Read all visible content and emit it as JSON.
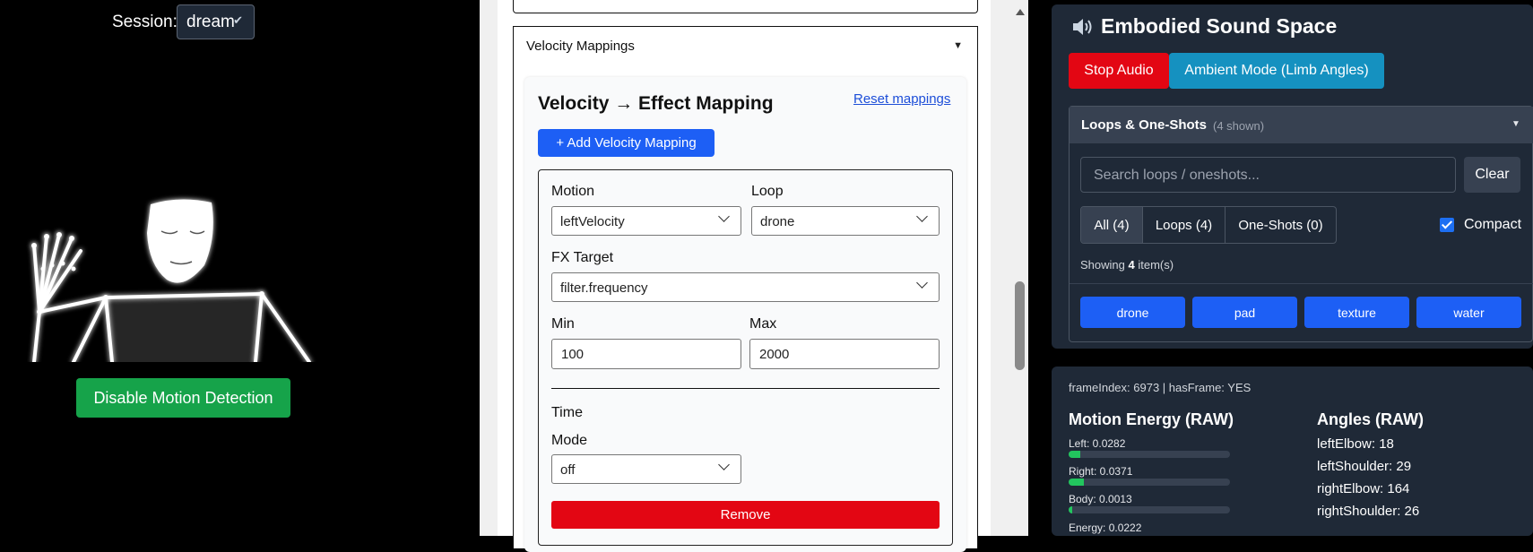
{
  "session": {
    "label": "Session:",
    "value": "dream"
  },
  "motion_button": "Disable Motion Detection",
  "velocity_section": {
    "header": "Velocity Mappings",
    "title": "Velocity → Effect Mapping",
    "reset_link": "Reset mappings",
    "add_button": "+ Add Velocity Mapping",
    "mapping": {
      "motion_label": "Motion",
      "motion_value": "leftVelocity",
      "loop_label": "Loop",
      "loop_value": "drone",
      "fx_label": "FX Target",
      "fx_value": "filter.frequency",
      "min_label": "Min",
      "min_value": "100",
      "max_label": "Max",
      "max_value": "2000",
      "time_label": "Time",
      "mode_label": "Mode",
      "mode_value": "off",
      "remove_button": "Remove"
    }
  },
  "sound_space": {
    "title": "Embodied Sound Space",
    "stop_button": "Stop Audio",
    "ambient_button": "Ambient Mode (Limb Angles)",
    "loops": {
      "title": "Loops & One-Shots",
      "count": "(4 shown)",
      "search_placeholder": "Search loops / oneshots...",
      "clear_button": "Clear",
      "filters": [
        "All (4)",
        "Loops (4)",
        "One-Shots (0)"
      ],
      "compact_label": "Compact",
      "compact_checked": true,
      "showing_prefix": "Showing",
      "showing_count": "4",
      "showing_suffix": "item(s)",
      "chips": [
        "drone",
        "pad",
        "texture",
        "water"
      ]
    }
  },
  "stats": {
    "frame_line": "frameIndex: 6973 | hasFrame: YES",
    "motion_energy_title": "Motion Energy (RAW)",
    "energy_rows": [
      {
        "label": "Left: 0.0282",
        "value": 0.0282
      },
      {
        "label": "Right: 0.0371",
        "value": 0.0371
      },
      {
        "label": "Body: 0.0013",
        "value": 0.0013
      },
      {
        "label": "Energy: 0.0222",
        "value": 0.0222
      }
    ],
    "angles_title": "Angles (RAW)",
    "angles": [
      "leftElbow: 18",
      "leftShoulder: 29",
      "rightElbow: 164",
      "rightShoulder: 26"
    ]
  },
  "colors": {
    "green": "#16a34a",
    "red": "#e30613",
    "blue": "#1d5ff5",
    "teal": "#1591c0",
    "panel": "#1f2937"
  }
}
